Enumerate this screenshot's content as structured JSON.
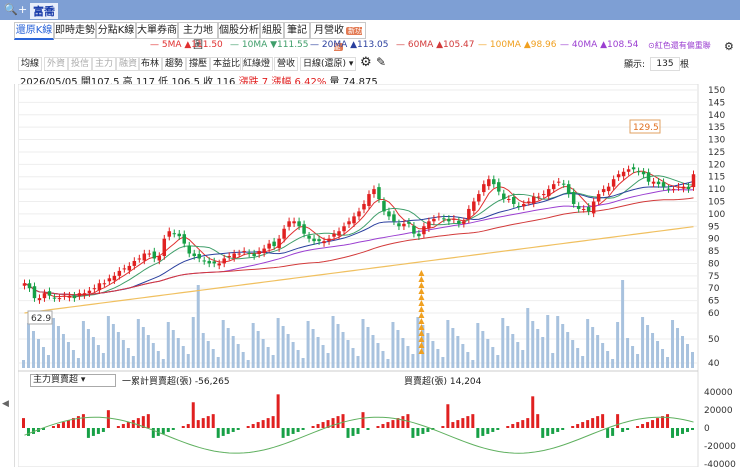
{
  "header": {
    "title": "富喬"
  },
  "tabs": [
    {
      "label": "還原K線",
      "active": true
    },
    {
      "label": "即時走勢"
    },
    {
      "label": "分點K線"
    },
    {
      "label": "大單券商"
    },
    {
      "label": "主力地圖"
    },
    {
      "label": "個股分析"
    },
    {
      "label": "組股"
    },
    {
      "label": "筆記"
    },
    {
      "label": "月營收",
      "badge": "新功能"
    }
  ],
  "ma": [
    {
      "label": "5MA ▲111.50",
      "color": "#e03030"
    },
    {
      "label": "10MA ▼111.55",
      "color": "#3f9e6a"
    },
    {
      "label": "20MA ▲113.05",
      "color": "#2a3f9e"
    },
    {
      "label": "60MA ▲105.47",
      "color": "#d23a3a"
    },
    {
      "label": "100MA ▲98.96",
      "color": "#f0a020"
    },
    {
      "label": "40MA ▲108.54",
      "color": "#9b3fd1"
    }
  ],
  "ma_note": "紅色還有偏重聯",
  "toolbar": {
    "items": [
      "均線",
      "外資",
      "投信",
      "主力",
      "融資",
      "布林",
      "趨勢",
      "撐壓",
      "本益比",
      "紅綠燈",
      "營收"
    ],
    "period": "日線(還原)",
    "display_label": "顯示:",
    "display_value": "135",
    "display_unit": "根"
  },
  "info": {
    "date": "2026/05/05",
    "open_l": "開",
    "open": "107.5",
    "high_l": "高",
    "high": "117",
    "low_l": "低",
    "low": "106.5",
    "close_l": "收",
    "close": "116",
    "chg_l": "漲跌",
    "chg": "7",
    "pct_l": "漲幅",
    "pct": "6.42%",
    "vol_l": "量",
    "vol": "74,875"
  },
  "chart_data": {
    "type": "candlestick",
    "y_ticks": [
      150,
      145,
      140,
      135,
      130,
      125,
      120,
      115,
      110,
      105,
      100,
      95,
      90,
      85,
      80,
      75,
      70,
      65,
      60,
      50,
      40
    ],
    "high_label": "129.5",
    "low_label": "62.9",
    "closes": [
      72,
      70,
      66,
      66,
      68,
      67,
      66,
      66,
      67,
      67,
      66,
      68,
      68,
      69,
      70,
      72,
      72,
      74,
      75,
      77,
      78,
      79,
      81,
      82,
      84,
      84,
      82,
      83,
      90,
      93,
      92,
      91,
      88,
      84,
      83,
      82,
      81,
      80,
      80,
      80,
      82,
      83,
      84,
      84,
      85,
      84,
      83,
      85,
      86,
      88,
      87,
      90,
      94,
      97,
      97,
      95,
      92,
      90,
      89,
      89,
      89,
      90,
      92,
      93,
      95,
      97,
      99,
      101,
      104,
      108,
      110,
      106,
      101,
      99,
      97,
      95,
      96,
      96,
      92,
      91,
      95,
      97,
      98,
      99,
      98,
      97,
      98,
      96,
      97,
      102,
      105,
      108,
      112,
      114,
      112,
      109,
      106,
      106,
      104,
      103,
      104,
      105,
      107,
      107,
      108,
      110,
      112,
      113,
      112,
      108,
      104,
      102,
      102,
      101,
      105,
      108,
      110,
      111,
      114,
      116,
      117,
      118,
      118,
      117,
      116,
      113,
      113,
      112,
      111,
      110,
      110,
      111,
      111,
      110,
      116
    ],
    "indicator": {
      "selector": "主力買賣超",
      "line_label": "一累計買賣超(張) -56,265",
      "bar_label": "買賣超(張) 14,204",
      "y_ticks": [
        40000,
        20000,
        0,
        -20000,
        -40000
      ]
    }
  }
}
